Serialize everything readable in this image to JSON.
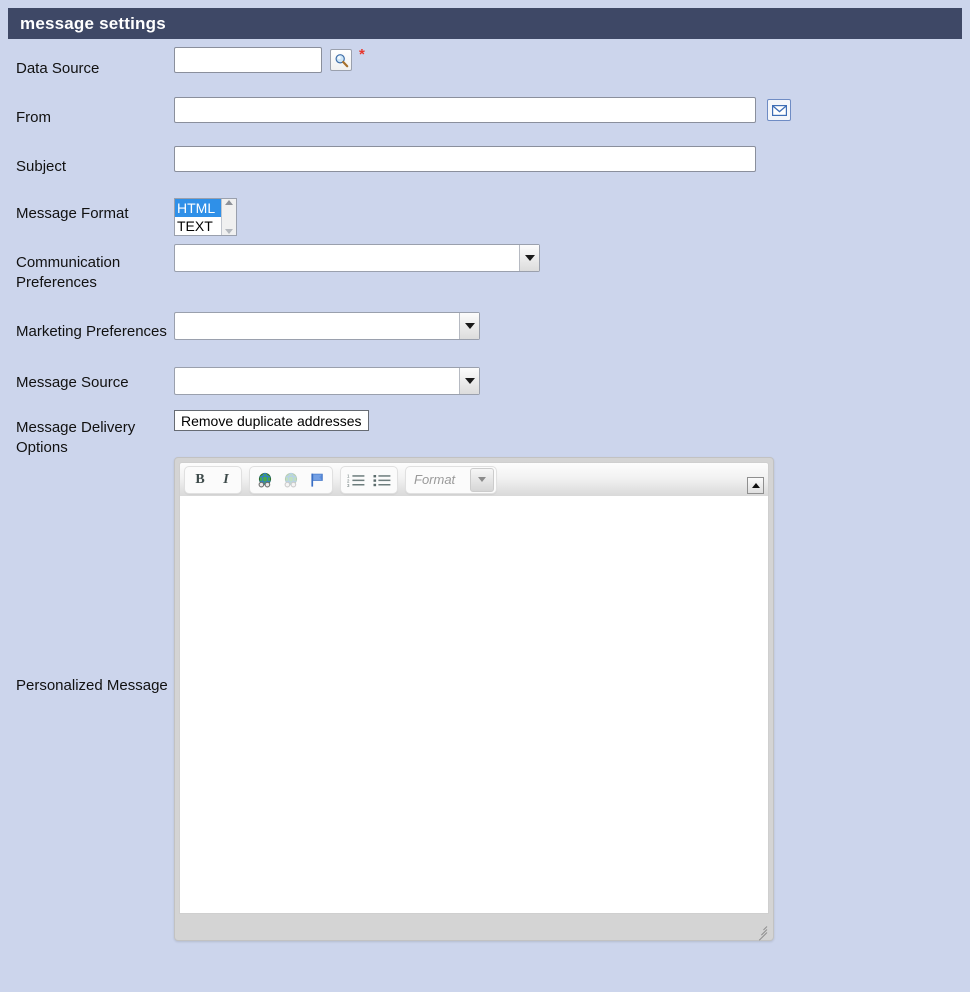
{
  "header": {
    "title": "message settings"
  },
  "fields": {
    "data_source": {
      "label": "Data Source",
      "value": "",
      "placeholder": "",
      "search_icon": "search-icon",
      "required_marker": "*"
    },
    "from": {
      "label": "From",
      "value": "",
      "placeholder": "",
      "mail_icon": "envelope-icon"
    },
    "subject": {
      "label": "Subject",
      "value": "",
      "placeholder": ""
    },
    "message_format": {
      "label": "Message Format",
      "options": [
        {
          "text": "HTML",
          "selected": true
        },
        {
          "text": "TEXT",
          "selected": false
        }
      ]
    },
    "communication_preferences": {
      "label": "Communication Preferences",
      "value": ""
    },
    "marketing_preferences": {
      "label": "Marketing Preferences",
      "value": ""
    },
    "message_source": {
      "label": "Message Source",
      "value": ""
    },
    "message_delivery_options": {
      "label": "Message Delivery Options",
      "option_text": "Remove duplicate addresses"
    },
    "personalized_message": {
      "label": "Personalized Message",
      "body_text": ""
    }
  },
  "editor": {
    "toolbar": {
      "bold_label": "B",
      "italic_label": "I",
      "link_icon": "globe-link-icon",
      "unlink_icon": "globe-unlink-icon",
      "anchor_icon": "flag-anchor-icon",
      "numbered_list_icon": "numbered-list-icon",
      "bulleted_list_icon": "bulleted-list-icon",
      "format_placeholder": "Format",
      "scroll_up_icon": "scroll-up-icon"
    },
    "resize_grip_icon": "resize-grip-icon"
  },
  "colors": {
    "page_background": "#ccd5ec",
    "header_background": "#3e4866",
    "header_text": "#ffffff",
    "required_star": "#e8352c",
    "list_selection": "#2f90e8"
  }
}
